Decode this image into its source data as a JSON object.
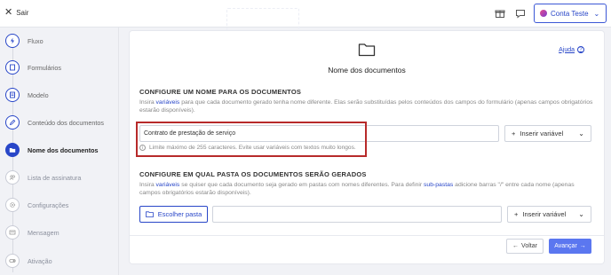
{
  "topbar": {
    "exit_label": "Sair",
    "account_label": "Conta Teste"
  },
  "sidebar": {
    "steps": [
      {
        "label": "Fluxo",
        "icon": "bolt-icon"
      },
      {
        "label": "Formulários",
        "icon": "form-icon"
      },
      {
        "label": "Modelo",
        "icon": "document-icon"
      },
      {
        "label": "Conteúdo dos documentos",
        "icon": "edit-icon"
      },
      {
        "label": "Nome dos documentos",
        "icon": "folder-icon"
      },
      {
        "label": "Lista de assinatura",
        "icon": "users-icon"
      },
      {
        "label": "Configurações",
        "icon": "gear-icon"
      },
      {
        "label": "Mensagem",
        "icon": "message-icon"
      },
      {
        "label": "Ativação",
        "icon": "toggle-icon"
      }
    ]
  },
  "card": {
    "title": "Nome dos documentos",
    "help_label": "Ajuda",
    "section1": {
      "title": "CONFIGURE UM NOME PARA OS DOCUMENTOS",
      "desc_pre": "Insira ",
      "desc_link": "variáveis",
      "desc_post": " para que cada documento gerado tenha nome diferente. Elas serão substituídas pelos conteúdos dos campos do formulário (apenas campos obrigatórios estarão disponíveis).",
      "name_value": "Contrato de prestação de serviço",
      "insert_label": "Inserir variável",
      "limit_note": "Limite máximo de 255 caracteres. Evite usar variáveis com textos muito longos."
    },
    "section2": {
      "title": "CONFIGURE EM QUAL PASTA OS DOCUMENTOS SERÃO GERADOS",
      "desc_pre": "Insira ",
      "desc_link": "variáveis",
      "desc_mid": " se quiser que cada documento seja gerado em pastas com nomes diferentes. Para definir ",
      "desc_link2": "sub-pastas",
      "desc_post": " adicione barras \"/\" entre cada nome (apenas campos obrigatórios estarão disponíveis).",
      "choose_label": "Escolher pasta",
      "folder_value": "",
      "insert_label": "Inserir variável"
    },
    "back_label": "Voltar",
    "next_label": "Avançar"
  }
}
